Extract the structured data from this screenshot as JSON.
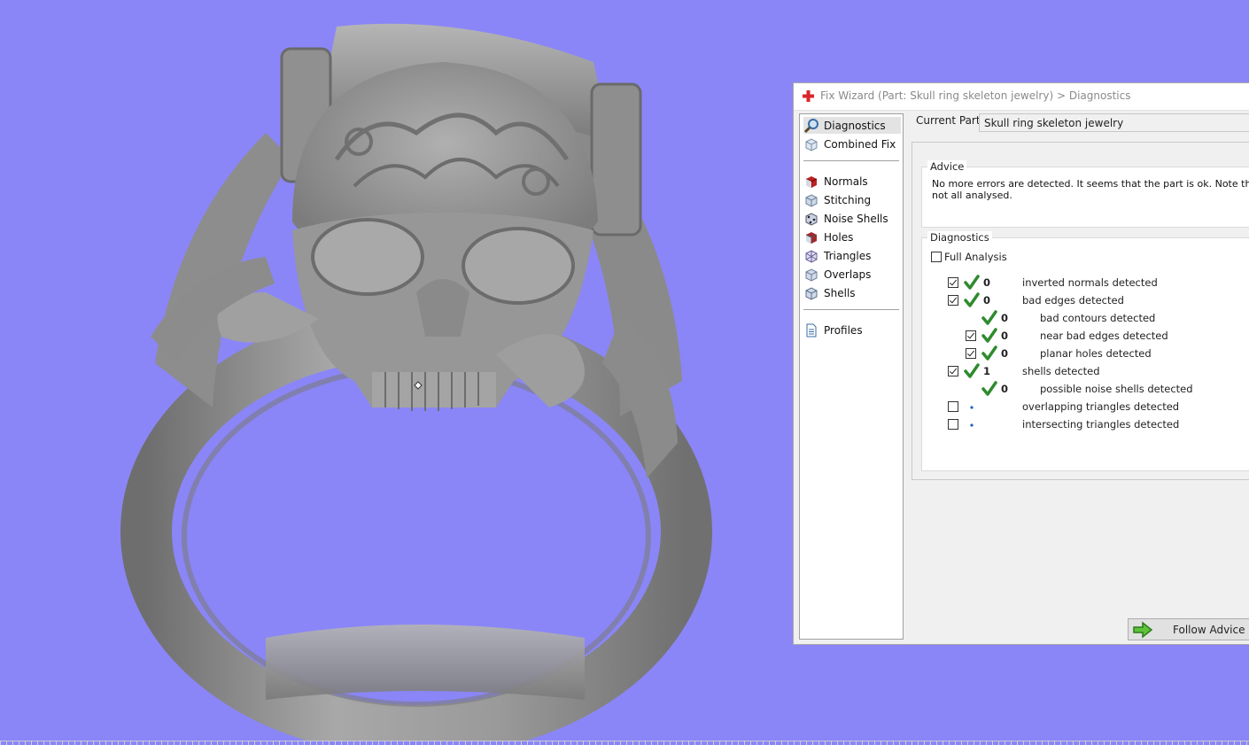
{
  "viewport": {
    "background": "#8a86f7",
    "model_color": "#8f8f8f"
  },
  "dialog": {
    "title": "Fix Wizard (Part: Skull ring skeleton jewelry) > Diagnostics",
    "current_part_label": "Current Part:",
    "current_part_value": "Skull ring skeleton jewelry",
    "nav": {
      "group1": [
        {
          "label": "Diagnostics",
          "icon": "magnifier-icon",
          "selected": true
        },
        {
          "label": "Combined Fix",
          "icon": "cube-outline-icon"
        }
      ],
      "group2": [
        {
          "label": "Normals",
          "icon": "normals-cube-icon"
        },
        {
          "label": "Stitching",
          "icon": "stitching-cube-icon"
        },
        {
          "label": "Noise Shells",
          "icon": "noise-shells-icon"
        },
        {
          "label": "Holes",
          "icon": "holes-cube-icon"
        },
        {
          "label": "Triangles",
          "icon": "triangles-cube-icon"
        },
        {
          "label": "Overlaps",
          "icon": "overlaps-cube-icon"
        },
        {
          "label": "Shells",
          "icon": "shells-cube-icon"
        }
      ],
      "group3": [
        {
          "label": "Profiles",
          "icon": "document-icon"
        }
      ]
    },
    "advice": {
      "title": "Advice",
      "text": "No more errors are detected. It seems that the part is ok. Note that not all analysed."
    },
    "diagnostics": {
      "title": "Diagnostics",
      "full_analysis_label": "Full Analysis",
      "full_analysis_checked": false,
      "rows": [
        {
          "checkbox": true,
          "checked": true,
          "status": "ok",
          "count": "0",
          "label": "inverted normals detected",
          "indent": 0
        },
        {
          "checkbox": true,
          "checked": true,
          "status": "ok",
          "count": "0",
          "label": "bad edges detected",
          "indent": 0
        },
        {
          "checkbox": false,
          "checked": false,
          "status": "ok",
          "count": "0",
          "label": "bad contours detected",
          "indent": 1
        },
        {
          "checkbox": true,
          "checked": true,
          "status": "ok",
          "count": "0",
          "label": "near bad edges detected",
          "indent": 1
        },
        {
          "checkbox": true,
          "checked": true,
          "status": "ok",
          "count": "0",
          "label": "planar holes detected",
          "indent": 1
        },
        {
          "checkbox": true,
          "checked": true,
          "status": "ok",
          "count": "1",
          "label": "shells detected",
          "indent": 0
        },
        {
          "checkbox": false,
          "checked": false,
          "status": "ok",
          "count": "0",
          "label": "possible noise shells detected",
          "indent": 1
        },
        {
          "checkbox": true,
          "checked": false,
          "status": "pending",
          "count": "",
          "label": "overlapping triangles detected",
          "indent": 0
        },
        {
          "checkbox": true,
          "checked": false,
          "status": "pending",
          "count": "",
          "label": "intersecting triangles detected",
          "indent": 0
        }
      ]
    },
    "follow_advice_label": "Follow Advice",
    "colors": {
      "check_green": "#2e8b2e",
      "pending_blue": "#1f5fbf",
      "title_red": "#d9262c"
    }
  }
}
